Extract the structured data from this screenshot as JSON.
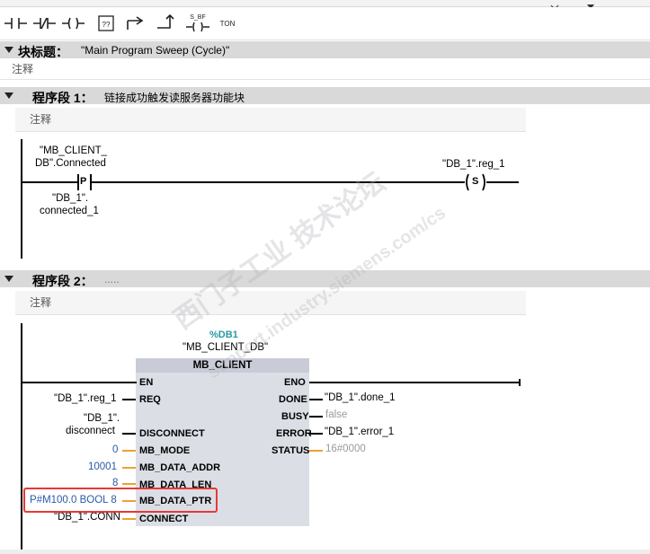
{
  "toolbar": {
    "buttons": [
      {
        "name": "no-contact-icon",
        "label": ""
      },
      {
        "name": "nc-contact-icon",
        "label": ""
      },
      {
        "name": "coil-icon",
        "label": ""
      },
      {
        "name": "empty-box-icon",
        "label": "??"
      },
      {
        "name": "branch-open-icon",
        "label": ""
      },
      {
        "name": "branch-close-icon",
        "label": ""
      },
      {
        "name": "s-bf-icon",
        "label": "S_BF"
      },
      {
        "name": "ton-icon",
        "label": "TON"
      }
    ]
  },
  "block": {
    "title_label": "块标题：",
    "title_value": "\"Main Program Sweep (Cycle)\"",
    "comment": "注释"
  },
  "network1": {
    "title": "程序段 1：",
    "subtitle": "链接成功触发读服务器功能块",
    "comment": "注释",
    "contact_tag_line1": "\"MB_CLIENT_",
    "contact_tag_line2": "DB\".Connected",
    "contact_symbol": "P",
    "edge_tag_line1": "\"DB_1\".",
    "edge_tag_line2": "connected_1",
    "coil_tag": "\"DB_1\".reg_1",
    "coil_symbol": "S"
  },
  "network2": {
    "title": "程序段 2：",
    "subtitle": ".....",
    "comment": "注释",
    "db_number": "%DB1",
    "db_name": "\"MB_CLIENT_DB\"",
    "fb_name": "MB_CLIENT",
    "inputs": [
      {
        "pin": "EN",
        "value": ""
      },
      {
        "pin": "REQ",
        "value": "\"DB_1\".reg_1"
      },
      {
        "pin": "DISCONNECT",
        "value_line1": "\"DB_1\".",
        "value_line2": "disconnect"
      },
      {
        "pin": "MB_MODE",
        "value": "0"
      },
      {
        "pin": "MB_DATA_ADDR",
        "value": "10001"
      },
      {
        "pin": "MB_DATA_LEN",
        "value": "8"
      },
      {
        "pin": "MB_DATA_PTR",
        "value": "P#M100.0 BOOL 8"
      },
      {
        "pin": "CONNECT",
        "value": "\"DB_1\".CONN"
      }
    ],
    "outputs": [
      {
        "pin": "ENO",
        "value": ""
      },
      {
        "pin": "DONE",
        "value": "\"DB_1\".done_1"
      },
      {
        "pin": "BUSY",
        "value": "false"
      },
      {
        "pin": "ERROR",
        "value": "\"DB_1\".error_1"
      },
      {
        "pin": "STATUS",
        "value": "16#0000"
      }
    ]
  },
  "watermark": {
    "line1": "西门子工业 技术论坛",
    "line2": "support.industry.siemens.com/cs"
  },
  "colors": {
    "highlight": "#e53935",
    "constant": "#2b5aa8",
    "pin_orange": "#f0a030",
    "db_teal": "#2a9aa6"
  }
}
